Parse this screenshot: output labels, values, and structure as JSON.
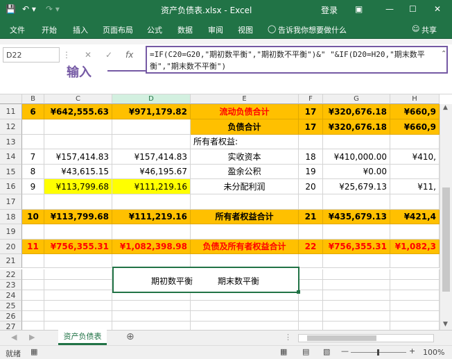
{
  "title": {
    "filename": "资产负债表.xlsx - Excel",
    "login": "登录"
  },
  "ribbon": {
    "tabs": [
      "文件",
      "开始",
      "插入",
      "页面布局",
      "公式",
      "数据",
      "审阅",
      "视图"
    ],
    "tellme": "告诉我你想要做什么",
    "share": "共享"
  },
  "formula_bar": {
    "name_box": "D22",
    "formula": "=IF(C20=G20,\"期初数平衡\",\"期初数不平衡\")&\"      \"&IF(D20=H20,\"期末数平衡\",\"期末数不平衡\")",
    "annotation": "输入"
  },
  "columns": [
    "B",
    "C",
    "D",
    "E",
    "F",
    "G",
    "H"
  ],
  "rows": [
    {
      "num": "11",
      "cells": [
        "6",
        "¥642,555.63",
        "¥971,179.82",
        "流动负债合计",
        "17",
        "¥320,676.18",
        "¥660,9"
      ]
    },
    {
      "num": "12",
      "cells": [
        "",
        "",
        "",
        "负债合计",
        "17",
        "¥320,676.18",
        "¥660,9"
      ]
    },
    {
      "num": "13",
      "cells": [
        "",
        "",
        "",
        "所有者权益:",
        "",
        "",
        ""
      ]
    },
    {
      "num": "14",
      "cells": [
        "7",
        "¥157,414.83",
        "¥157,414.83",
        "实收资本",
        "18",
        "¥410,000.00",
        "¥410,"
      ]
    },
    {
      "num": "15",
      "cells": [
        "8",
        "¥43,615.15",
        "¥46,195.67",
        "盈余公积",
        "19",
        "¥0.00",
        ""
      ]
    },
    {
      "num": "16",
      "cells": [
        "9",
        "¥113,799.68",
        "¥111,219.16",
        "未分配利润",
        "20",
        "¥25,679.13",
        "¥11,"
      ]
    },
    {
      "num": "17",
      "cells": [
        "",
        "",
        "",
        "",
        "",
        "",
        ""
      ]
    },
    {
      "num": "18",
      "cells": [
        "10",
        "¥113,799.68",
        "¥111,219.16",
        "所有者权益合计",
        "21",
        "¥435,679.13",
        "¥421,4"
      ]
    },
    {
      "num": "19",
      "cells": [
        "",
        "",
        "",
        "",
        "",
        "",
        ""
      ]
    },
    {
      "num": "20",
      "cells": [
        "11",
        "¥756,355.31",
        "¥1,082,398.98",
        "负债及所有者权益合计",
        "22",
        "¥756,355.31",
        "¥1,082,3"
      ]
    },
    {
      "num": "21",
      "cells": [
        "",
        "",
        "",
        "",
        "",
        "",
        ""
      ]
    }
  ],
  "merged_result": {
    "text1": "期初数平衡",
    "text2": "期末数平衡"
  },
  "empty_rows": [
    "22",
    "23",
    "24",
    "25",
    "26",
    "27"
  ],
  "sheet_tab": "资产负债表",
  "status": {
    "ready": "就绪",
    "zoom": "100%"
  },
  "colors": {
    "accent": "#217346",
    "orange": "#ffc000",
    "yellow": "#ffff00",
    "red_text": "#ff0000",
    "annotation": "#7559a4"
  }
}
